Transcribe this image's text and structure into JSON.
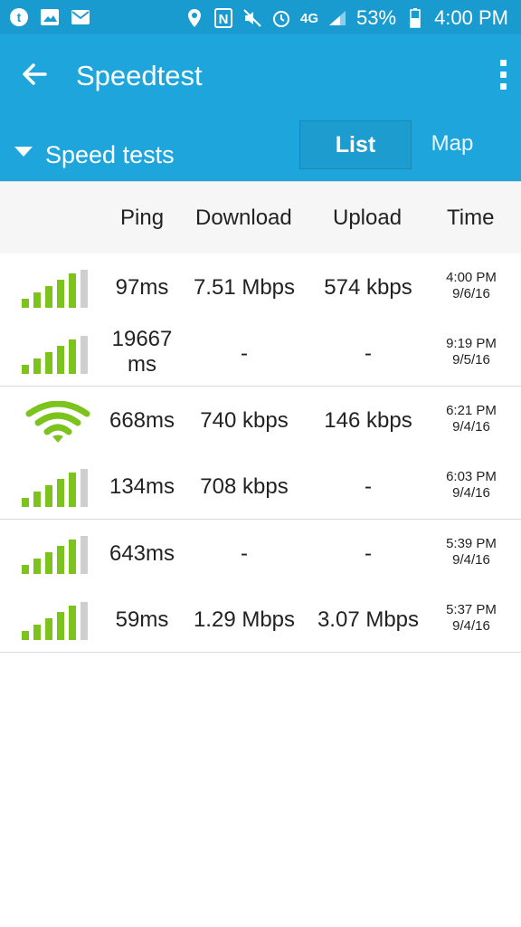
{
  "status_bar": {
    "battery": "53%",
    "time": "4:00 PM",
    "network": "4G"
  },
  "app_bar": {
    "title": "Speedtest",
    "dropdown_label": "Speed tests",
    "tabs": [
      {
        "label": "List",
        "selected": true
      },
      {
        "label": "Map",
        "selected": false
      }
    ]
  },
  "table": {
    "headers": [
      "Ping",
      "Download",
      "Upload",
      "Time"
    ],
    "rows": [
      {
        "type": "cellular",
        "ping": "97ms",
        "download": "7.51 Mbps",
        "upload": "574 kbps",
        "time": "4:00 PM",
        "date": "9/6/16"
      },
      {
        "type": "cellular",
        "ping": "19667 ms",
        "download": "-",
        "upload": "-",
        "time": "9:19 PM",
        "date": "9/5/16"
      },
      {
        "type": "wifi",
        "ping": "668ms",
        "download": "740 kbps",
        "upload": "146 kbps",
        "time": "6:21 PM",
        "date": "9/4/16"
      },
      {
        "type": "cellular",
        "ping": "134ms",
        "download": "708 kbps",
        "upload": "-",
        "time": "6:03 PM",
        "date": "9/4/16"
      },
      {
        "type": "cellular",
        "ping": "643ms",
        "download": "-",
        "upload": "-",
        "time": "5:39 PM",
        "date": "9/4/16"
      },
      {
        "type": "cellular",
        "ping": "59ms",
        "download": "1.29 Mbps",
        "upload": "3.07 Mbps",
        "time": "5:37 PM",
        "date": "9/4/16"
      }
    ]
  },
  "colors": {
    "app_bar": "#1ea6dc",
    "status_bar": "#1a9bcf",
    "signal_green": "#7cc31e"
  }
}
